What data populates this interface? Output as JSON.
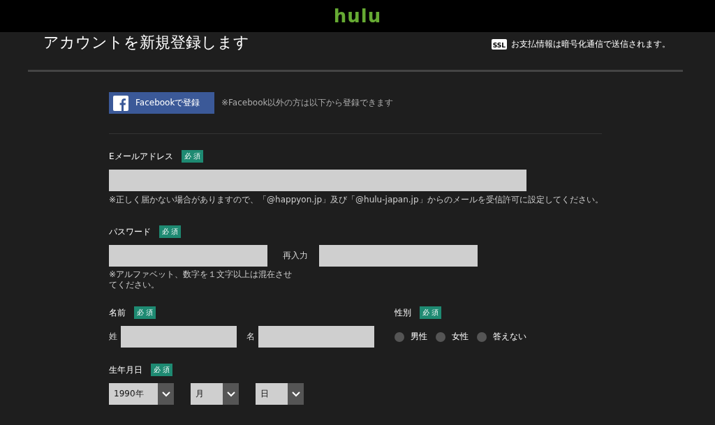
{
  "header": {
    "logo": "hulu"
  },
  "title": "アカウントを新規登録します",
  "ssl_note": {
    "badge": "SSL",
    "text": "お支払情報は暗号化通信で送信されます。"
  },
  "facebook": {
    "button": "Facebookで登録",
    "note": "※Facebook以外の方は以下から登録できます"
  },
  "email": {
    "label": "Eメールアドレス",
    "required": "必 須",
    "note": "※正しく届かない場合がありますので、「@happyon.jp」及び「@hulu-japan.jp」からのメールを受信許可に設定してください。"
  },
  "password": {
    "label": "パスワード",
    "required": "必 須",
    "confirm_label": "再入力",
    "note": "※アルファベット、数字を１文字以上は混在させてください。"
  },
  "name": {
    "label": "名前",
    "required": "必 須",
    "last_label": "姓",
    "first_label": "名"
  },
  "gender": {
    "label": "性別",
    "required": "必 須",
    "options": [
      {
        "label": "男性",
        "selected": false
      },
      {
        "label": "女性",
        "selected": false
      },
      {
        "label": "答えない",
        "selected": false
      }
    ]
  },
  "birthdate": {
    "label": "生年月日",
    "required": "必 須",
    "selects": [
      "1990年",
      "月",
      "日"
    ]
  }
}
